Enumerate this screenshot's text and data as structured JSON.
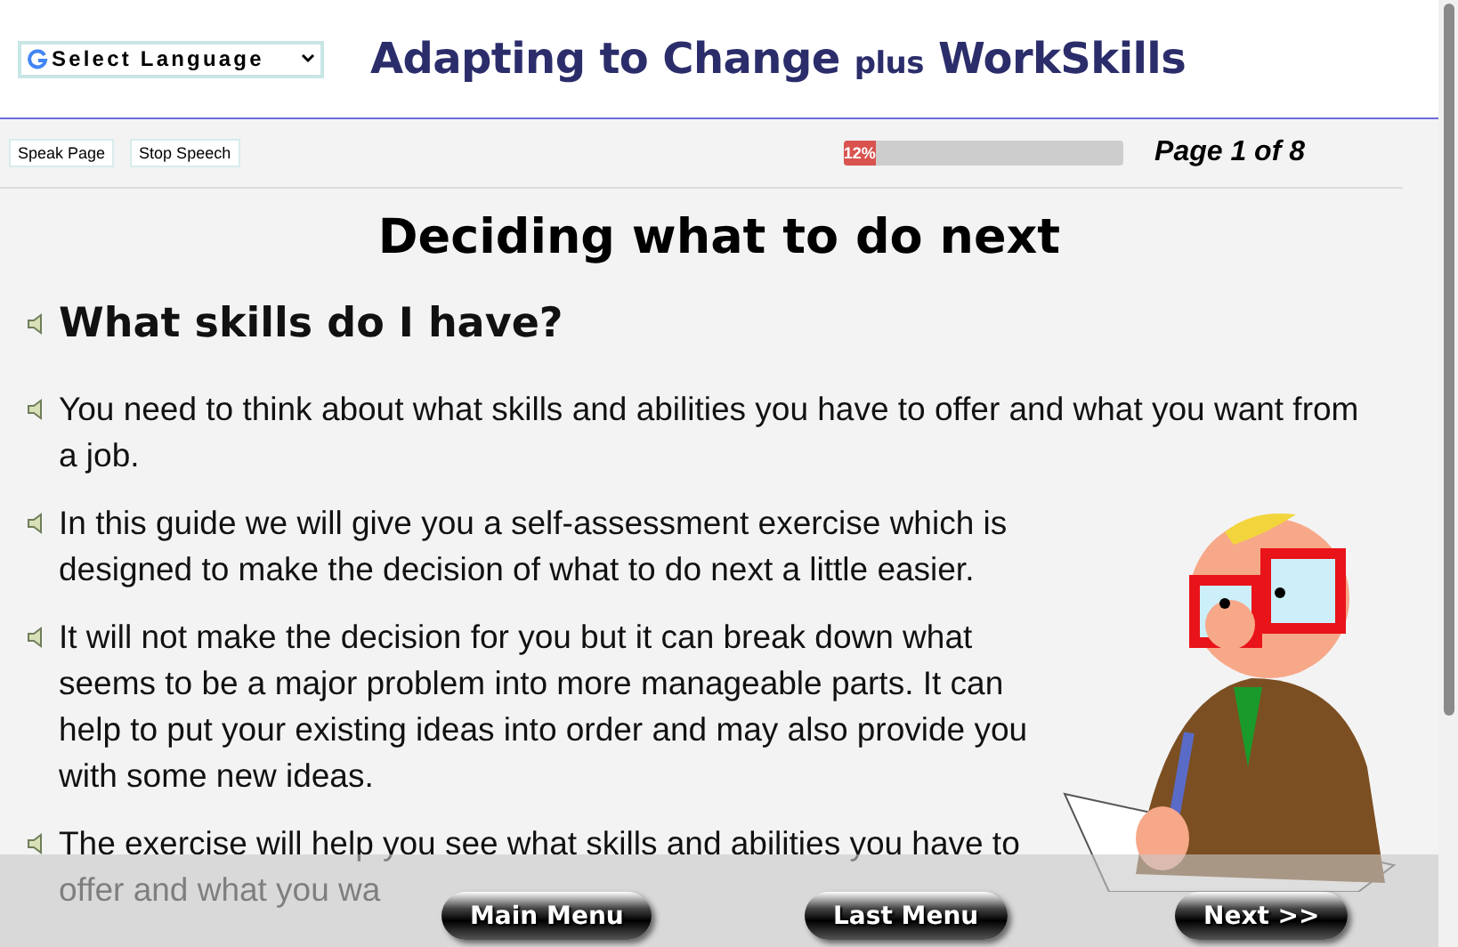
{
  "header": {
    "language_select": "Select Language",
    "title": "Adapting to Change",
    "title_small": "plus",
    "title_end": "WorkSkills"
  },
  "toolbar": {
    "buttons": [
      "Speak Page",
      "Stop Speech"
    ],
    "progress": {
      "level": 0.12,
      "label": "12%"
    },
    "page": "Page 1 of 8"
  },
  "page_title": "Deciding what to do next",
  "items": [
    {
      "kind": "heading",
      "text": "What skills do I have?"
    },
    {
      "kind": "text",
      "text": "You need to think about what skills and abilities you have to offer and what you want from a job."
    },
    {
      "kind": "text",
      "text": "In this guide we will give you a self-assessment exercise which is designed to make the decision of what to do next a little easier."
    },
    {
      "kind": "text",
      "text": "It will not make the decision for you but it can break down what seems to be a major problem into more manageable parts. It can help to put your existing ideas into order and may also provide you with some new ideas."
    },
    {
      "kind": "text",
      "text": "The exercise will help you see what skills and abilities you have to offer and what you wa"
    }
  ],
  "footer": {
    "buttons": [
      "Main Menu",
      "Last Menu",
      "Next >>"
    ]
  }
}
